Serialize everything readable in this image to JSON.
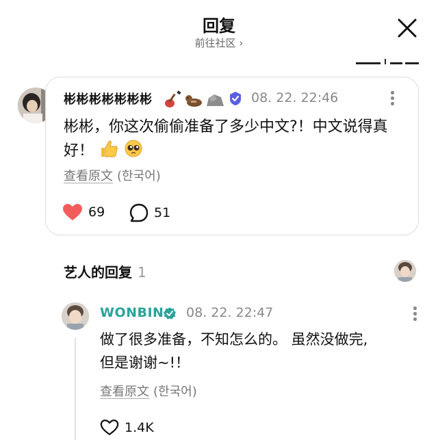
{
  "header": {
    "title": "回复",
    "subtitle": "前往社区 ›"
  },
  "post": {
    "author": "彬彬彬彬彬彬彬",
    "author_emojis": [
      "guitar-icon",
      "otter-icon",
      "rock-icon"
    ],
    "time": "08. 22. 22:46",
    "text": "彬彬，你这次偷偷准备了多少中文?！中文说得真好！",
    "text_emojis": [
      "thumbs-up-icon",
      "pleading-face-icon"
    ],
    "translate_label": "查看原文",
    "translate_lang": "(한국어)",
    "likes": "69",
    "comments": "51",
    "like_color": "#f45b5b"
  },
  "artist_section": {
    "title": "艺人的回复",
    "count": "1"
  },
  "reply": {
    "author": "WONBIN",
    "author_color": "#2aa39a",
    "time": "08. 22. 22:47",
    "text_line1": "做了很多准备，不知怎么的。 虽然没做完,",
    "text_line2": "但是谢谢~!！",
    "translate_label": "查看原文",
    "translate_lang": "(한국어)",
    "likes": "1.4K"
  }
}
